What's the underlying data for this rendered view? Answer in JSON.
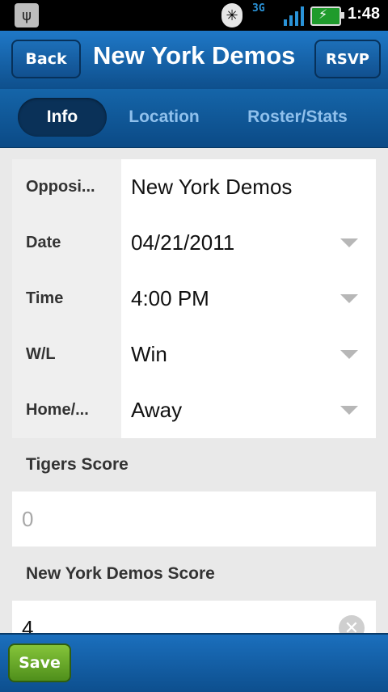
{
  "status_bar": {
    "usb_icon": "usb-icon",
    "bluetooth_icon": "bluetooth-icon",
    "network": "3G",
    "time": "1:48"
  },
  "header": {
    "back_label": "Back",
    "title": "New York Demos",
    "rsvp_label": "RSVP"
  },
  "tabs": [
    {
      "label": "Info",
      "active": true
    },
    {
      "label": "Location",
      "active": false
    },
    {
      "label": "Roster/Stats",
      "active": false
    }
  ],
  "form": {
    "rows": [
      {
        "label": "Opposi...",
        "value": "New York Demos",
        "dropdown": false
      },
      {
        "label": "Date",
        "value": "04/21/2011",
        "dropdown": true
      },
      {
        "label": "Time",
        "value": "4:00 PM",
        "dropdown": true
      },
      {
        "label": "W/L",
        "value": "Win",
        "dropdown": true
      },
      {
        "label": "Home/...",
        "value": "Away",
        "dropdown": true
      }
    ],
    "tigers_score_label": "Tigers Score",
    "tigers_score_placeholder": "0",
    "opponent_score_label": "New York Demos Score",
    "opponent_score_value": "4"
  },
  "bottom": {
    "save_label": "Save"
  },
  "colors": {
    "header_blue": "#1f78c7",
    "save_green": "#6fb02f"
  }
}
